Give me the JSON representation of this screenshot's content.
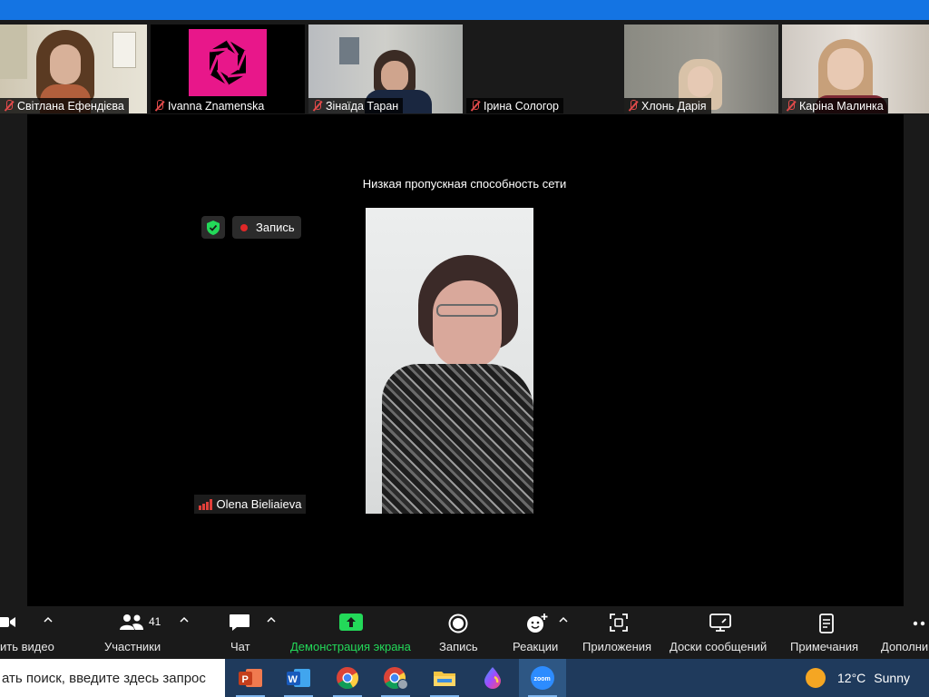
{
  "participants": [
    {
      "name": "Світлана Ефендієва"
    },
    {
      "name": "Ivanna Znamenska"
    },
    {
      "name": "Зінаїда Таран"
    },
    {
      "name": "Ірина Сологор"
    },
    {
      "name": "Хлонь Дарія"
    },
    {
      "name": "Каріна Малинка"
    }
  ],
  "stage": {
    "network_warning": "Низкая пропускная способность сети",
    "recording_label": "Запись",
    "active_speaker": "Olena Bieliaieva"
  },
  "toolbar": {
    "video_label": "ить видео",
    "participants_label": "Участники",
    "participants_count": "41",
    "chat_label": "Чат",
    "share_label": "Демонстрация экрана",
    "record_label": "Запись",
    "reactions_label": "Реакции",
    "apps_label": "Приложения",
    "whiteboards_label": "Доски сообщений",
    "notes_label": "Примечания",
    "more_label": "Дополни"
  },
  "taskbar": {
    "search_placeholder": "ать поиск, введите здесь запрос",
    "apps": [
      "PowerPoint",
      "Word",
      "Chrome",
      "Chrome profile",
      "File Explorer",
      "Paint",
      "Zoom"
    ],
    "zoom_app_label": "zoom",
    "weather_temp": "12°C",
    "weather_desc": "Sunny"
  },
  "colors": {
    "accent_blue": "#1474e3",
    "share_green": "#23d959",
    "muted_red": "#e24a4a",
    "record_red": "#e02828",
    "zoom_logo_pink": "#e8178a"
  }
}
